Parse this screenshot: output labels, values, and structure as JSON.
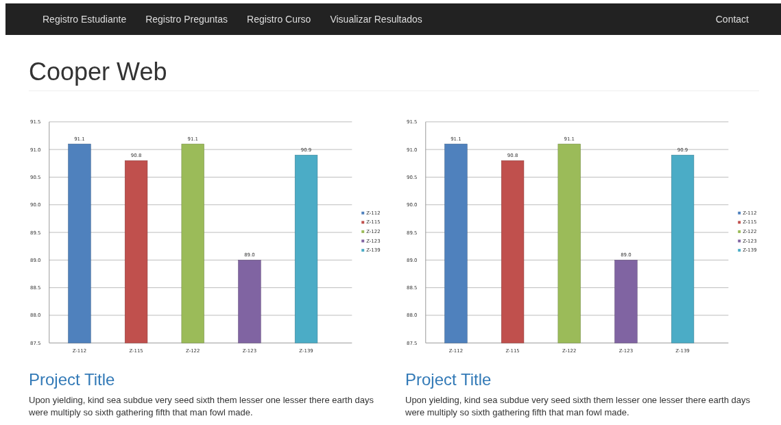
{
  "navbar": {
    "links": [
      {
        "label": "Registro Estudiante"
      },
      {
        "label": "Registro Preguntas"
      },
      {
        "label": "Registro Curso"
      },
      {
        "label": "Visualizar Resultados"
      }
    ],
    "right_links": [
      {
        "label": "Contact"
      }
    ]
  },
  "heading": "Cooper Web",
  "projects": [
    {
      "chart_data": {
        "type": "bar",
        "grid": true,
        "categories": [
          "Z-112",
          "Z-115",
          "Z-122",
          "Z-123",
          "Z-139"
        ],
        "values": [
          91.1,
          90.8,
          91.1,
          89.0,
          90.9
        ],
        "ylim": [
          87.5,
          91.5
        ],
        "yticks": [
          {
            "value": 87.5,
            "label": "87.5"
          },
          {
            "value": 88,
            "label": "88.0"
          },
          {
            "value": 88.5,
            "label": "88.5"
          },
          {
            "value": 89,
            "label": "89.0"
          },
          {
            "value": 89.5,
            "label": "89.5"
          },
          {
            "value": 90,
            "label": "90.0"
          },
          {
            "value": 90.5,
            "label": "90.5"
          },
          {
            "value": 91,
            "label": "91.0"
          },
          {
            "value": 91.5,
            "label": "91.5"
          }
        ],
        "value_labels": [
          "91.1",
          "90.8",
          "91.1",
          "89.0",
          "90.9"
        ]
      },
      "legend": [
        {
          "label": "Z-112",
          "color": "#4f81bd"
        },
        {
          "label": "Z-115",
          "color": "#c0504d"
        },
        {
          "label": "Z-122",
          "color": "#9bbb59"
        },
        {
          "label": "Z-123",
          "color": "#8064a2"
        },
        {
          "label": "Z-139",
          "color": "#4bacc6"
        }
      ],
      "title": "Project Title",
      "text": "Upon yielding, kind sea subdue very seed sixth them lesser one lesser there earth days were multiply so sixth gathering fifth that man fowl made."
    },
    {
      "chart_data": {
        "type": "bar",
        "grid": true,
        "categories": [
          "Z-112",
          "Z-115",
          "Z-122",
          "Z-123",
          "Z-139"
        ],
        "values": [
          91.1,
          90.8,
          91.1,
          89.0,
          90.9
        ],
        "ylim": [
          87.5,
          91.5
        ],
        "yticks": [
          {
            "value": 87.5,
            "label": "87.5"
          },
          {
            "value": 88,
            "label": "88.0"
          },
          {
            "value": 88.5,
            "label": "88.5"
          },
          {
            "value": 89,
            "label": "89.0"
          },
          {
            "value": 89.5,
            "label": "89.5"
          },
          {
            "value": 90,
            "label": "90.0"
          },
          {
            "value": 90.5,
            "label": "90.5"
          },
          {
            "value": 91,
            "label": "91.0"
          },
          {
            "value": 91.5,
            "label": "91.5"
          }
        ],
        "value_labels": [
          "91.1",
          "90.8",
          "91.1",
          "89.0",
          "90.9"
        ]
      },
      "legend": [
        {
          "label": "Z-112",
          "color": "#4f81bd"
        },
        {
          "label": "Z-115",
          "color": "#c0504d"
        },
        {
          "label": "Z-122",
          "color": "#9bbb59"
        },
        {
          "label": "Z-123",
          "color": "#8064a2"
        },
        {
          "label": "Z-139",
          "color": "#4bacc6"
        }
      ],
      "title": "Project Title",
      "text": "Upon yielding, kind sea subdue very seed sixth them lesser one lesser there earth days were multiply so sixth gathering fifth that man fowl made."
    }
  ]
}
